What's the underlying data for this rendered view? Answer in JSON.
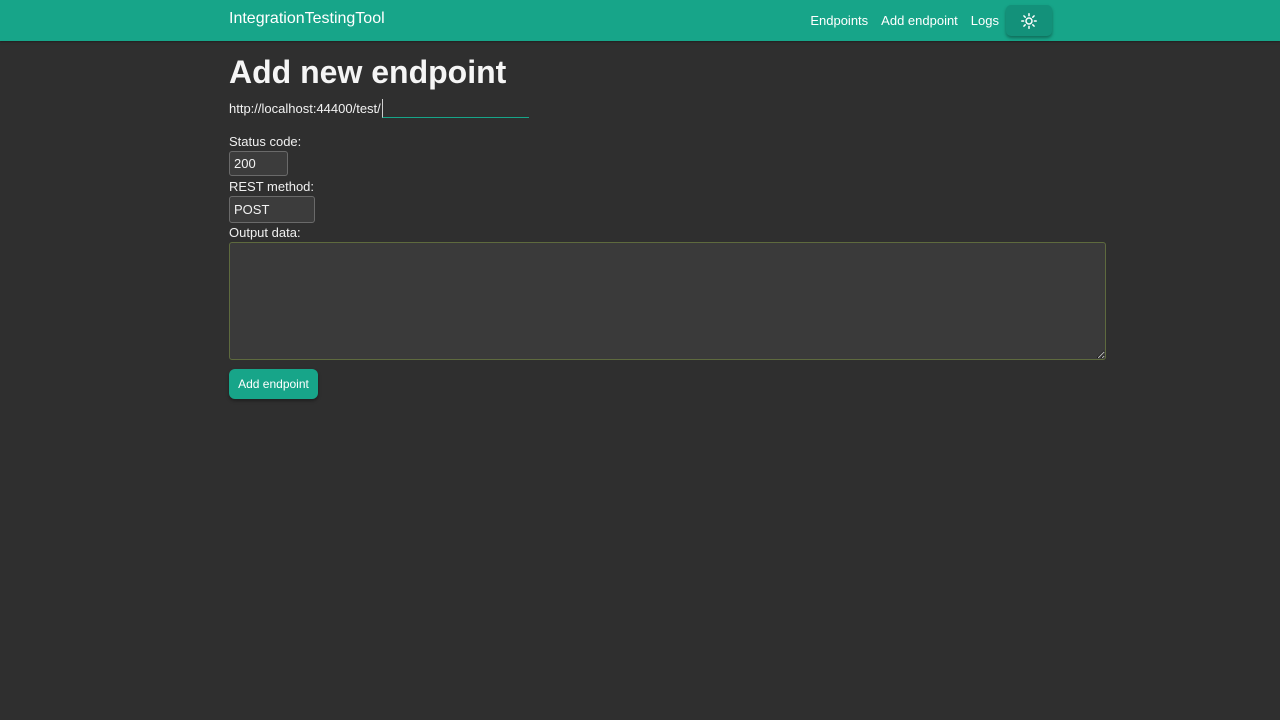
{
  "navbar": {
    "brand": "IntegrationTestingTool",
    "links": [
      "Endpoints",
      "Add endpoint",
      "Logs"
    ],
    "theme_toggle_icon": "sun-icon",
    "color": "#17a589"
  },
  "form": {
    "title": "Add new endpoint",
    "url_prefix": "http://localhost:44400/test/",
    "url_value": "",
    "status_code_label": "Status code:",
    "status_code_value": "200",
    "rest_method_label": "REST method:",
    "rest_method_value": "POST",
    "output_label": "Output data:",
    "output_value": "",
    "submit_label": "Add endpoint"
  },
  "theme": {
    "background": "#2f2f2f",
    "accent": "#17a589"
  }
}
